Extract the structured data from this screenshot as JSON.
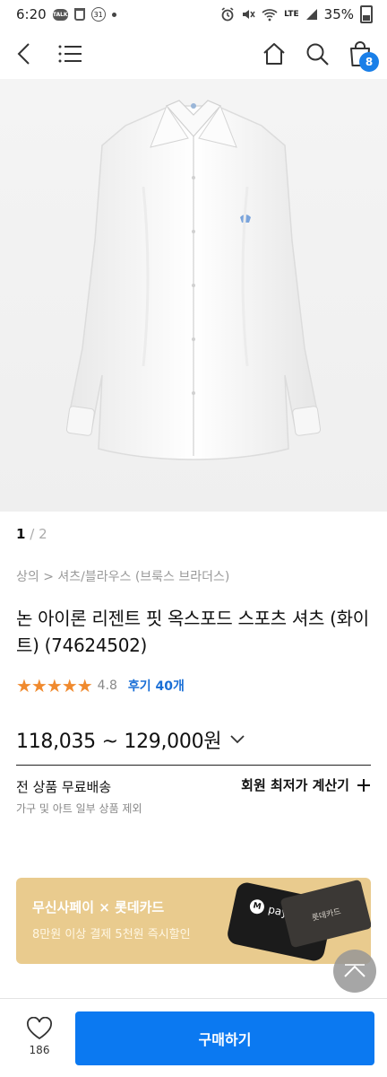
{
  "status_bar": {
    "time": "6:20",
    "calendar_day": "31",
    "network": "LTE",
    "battery": "35%"
  },
  "gallery": {
    "current": "1",
    "total": "2",
    "separator": "/"
  },
  "product": {
    "breadcrumb": "상의 > 셔츠/블라우스 (브룩스 브라더스)",
    "title": "논 아이론 리젠트 핏 옥스포드 스포츠 셔츠 (화이트) (74624502)",
    "stars": "★★★★★",
    "rating": "4.8",
    "reviews": "후기 40개",
    "price": "118,035 ~ 129,000원"
  },
  "shipping": {
    "label": "전 상품 무료배송",
    "note": "가구 및 아트 일부 상품 제외",
    "calc_label": "회원 최저가 계산기"
  },
  "promo": {
    "title": "무신사페이 × 롯데카드",
    "subtitle": "8만원 이상 결제 5천원 즉시할인",
    "phone_label": "pay",
    "phone_logo": "M",
    "card_label": "롯데카드"
  },
  "bottom": {
    "like_count": "186",
    "buy_label": "구매하기"
  },
  "icons": {
    "back": "back-icon",
    "menu": "menu-icon",
    "home": "home-icon",
    "search": "search-icon",
    "cart": "cart-icon",
    "cart_count": "8",
    "heart": "heart-icon",
    "plus": "plus-icon",
    "chevron": "chevron-down-icon",
    "scroll_top": "chevron-up-icon"
  },
  "colors": {
    "accent": "#0b79f1",
    "star": "#f08a2e",
    "link": "#1a6fd6",
    "promo": "#e9cb8e"
  }
}
